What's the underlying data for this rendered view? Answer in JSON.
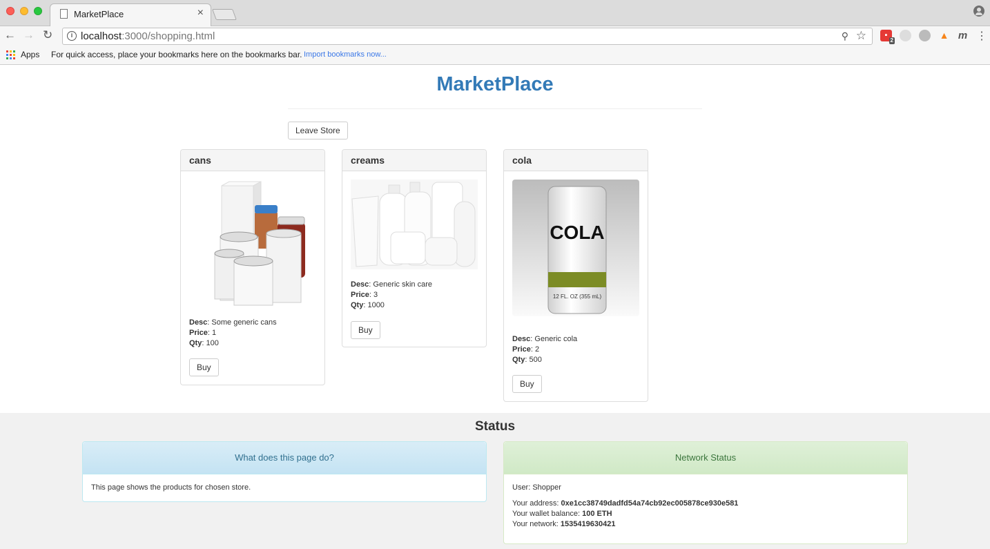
{
  "browser": {
    "tab_title": "MarketPlace",
    "tab_close": "×",
    "url_host": "localhost",
    "url_path": ":3000/shopping.html",
    "bookmarks": {
      "apps_label": "Apps",
      "hint": "For quick access, place your bookmarks here on the bookmarks bar.",
      "import_link": "Import bookmarks now..."
    },
    "extension_badge": "2"
  },
  "page": {
    "title": "MarketPlace",
    "leave_button": "Leave Store"
  },
  "products": [
    {
      "name": "cans",
      "desc_label": "Desc",
      "desc": ": Some generic cans",
      "price_label": "Price",
      "price": ": 1",
      "qty_label": "Qty",
      "qty": ": 100",
      "buy_label": "Buy"
    },
    {
      "name": "creams",
      "desc_label": "Desc",
      "desc": ": Generic skin care",
      "price_label": "Price",
      "price": ": 3",
      "qty_label": "Qty",
      "qty": ": 1000",
      "buy_label": "Buy"
    },
    {
      "name": "cola",
      "desc_label": "Desc",
      "desc": ": Generic cola",
      "price_label": "Price",
      "price": ": 2",
      "qty_label": "Qty",
      "qty": ": 500",
      "buy_label": "Buy",
      "can_text": "COLA",
      "can_small": "12 FL. OZ (355 mL)"
    }
  ],
  "status": {
    "title": "Status",
    "info_panel": {
      "heading": "What does this page do?",
      "body": "This page shows the products for chosen store."
    },
    "network_panel": {
      "heading": "Network Status",
      "user": "User: Shopper",
      "address_label": "Your address: ",
      "address": "0xe1cc38749dadfd54a74cb92ec005878ce930e581",
      "balance_label": "Your wallet balance: ",
      "balance": "100 ETH",
      "network_label": "Your network: ",
      "network": "1535419630421"
    }
  }
}
